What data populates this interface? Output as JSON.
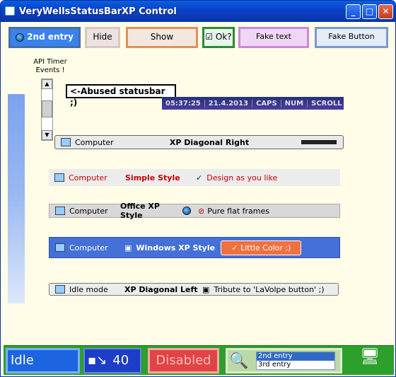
{
  "window": {
    "title": "VeryWellsStatusBarXP Control"
  },
  "toolbar": {
    "btn1": "2nd entry",
    "btn2": "Hide",
    "btn3": "Show",
    "btn4": "Ok?",
    "btn5": "Fake text",
    "btn6": "Fake Button"
  },
  "api_label": "API Timer Events !",
  "abused": "<-Abused statusbar ;)",
  "clock": {
    "time": "05:37:25",
    "date": "21.4.2013",
    "caps": "CAPS",
    "num": "NUM",
    "scroll": "SCROLL"
  },
  "bar1": {
    "p1": "Computer",
    "p2": "XP Diagonal Right"
  },
  "bar2": {
    "p1": "Computer",
    "p2": "Simple Style",
    "p3": "Design as you like"
  },
  "bar3": {
    "p1": "Computer",
    "p2": "Office XP Style",
    "p3": "Pure flat frames"
  },
  "bar4": {
    "p1": "Computer",
    "p2": "Windows XP Style",
    "p3": "Little Color ;)"
  },
  "bar5": {
    "p1": "Idle mode",
    "p2": "XP Diagonal Left",
    "p3": "Tribute to  'LaVolpe button' ;)"
  },
  "status": {
    "idle": "Idle",
    "count": "40",
    "disabled": "Disabled",
    "list": [
      "2nd entry",
      "3rd entry"
    ]
  }
}
